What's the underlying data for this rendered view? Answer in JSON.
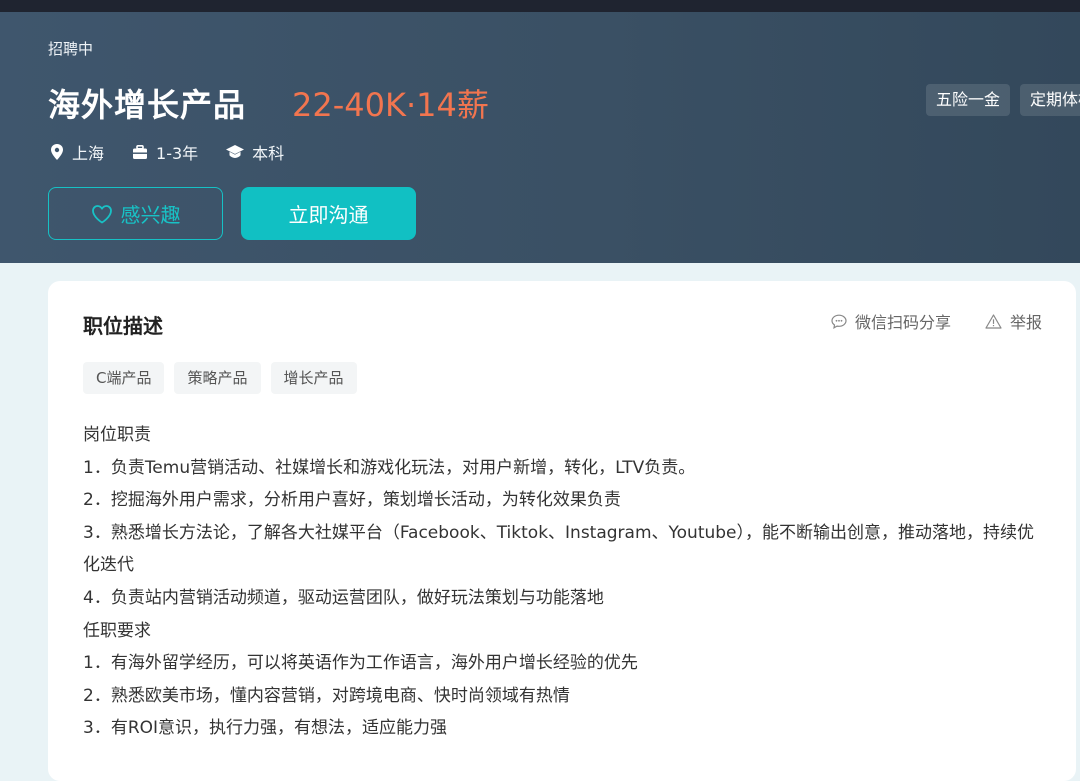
{
  "hero": {
    "status": "招聘中",
    "title": "海外增长产品",
    "salary": "22-40K·14薪",
    "meta": {
      "location": "上海",
      "experience": "1-3年",
      "education": "本科"
    },
    "benefits": [
      "五险一金",
      "定期体检"
    ],
    "interest_label": "感兴趣",
    "chat_label": "立即沟通"
  },
  "card": {
    "section_title": "职位描述",
    "share_label": "微信扫码分享",
    "report_label": "举报",
    "tags": [
      "C端产品",
      "策略产品",
      "增长产品"
    ],
    "lines": [
      "岗位职责",
      "1．负责Temu营销活动、社媒增长和游戏化玩法，对用户新增，转化，LTV负责。",
      "2．挖掘海外用户需求，分析用户喜好，策划增长活动，为转化效果负责",
      "3．熟悉增长方法论，了解各大社媒平台（Facebook、Tiktok、Instagram、Youtube），能不断输出创意，推动落地，持续优化迭代",
      "4．负责站内营销活动频道，驱动运营团队，做好玩法策划与功能落地",
      "任职要求",
      "1．有海外留学经历，可以将英语作为工作语言，海外用户增长经验的优先",
      "2．熟悉欧美市场，懂内容营销，对跨境电商、快时尚领域有热情",
      "3．有ROI意识，执行力强，有想法，适应能力强"
    ]
  },
  "colors": {
    "accent": "#11c0c3",
    "salary": "#f2754f",
    "hero_bg": "#3f566d"
  }
}
